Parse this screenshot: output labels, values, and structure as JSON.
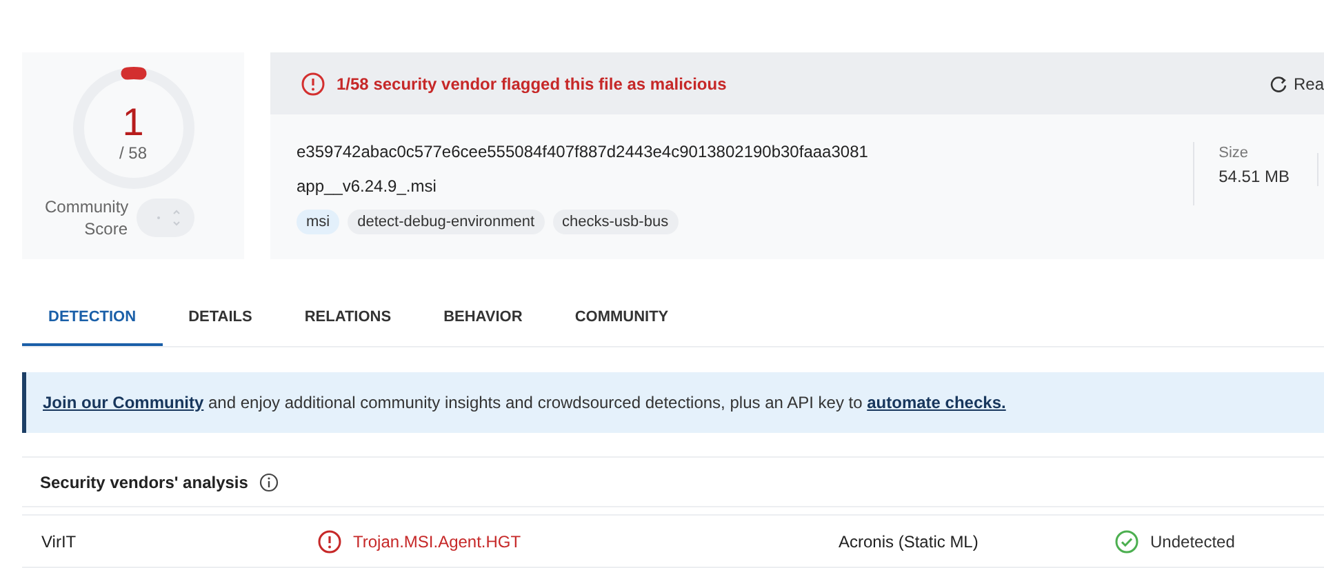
{
  "score": {
    "detections": "1",
    "total": "/ 58",
    "label": "Community Score"
  },
  "alert": {
    "text": "1/58 security vendor flagged this file as malicious",
    "action": "Rea"
  },
  "file": {
    "hash": "e359742abac0c577e6cee555084f407f887d2443e4c9013802190b30faaa3081",
    "name": "app__v6.24.9_.msi",
    "tags": [
      {
        "label": "msi",
        "color": "#e3f0fb"
      },
      {
        "label": "detect-debug-environment",
        "color": "#eceef1"
      },
      {
        "label": "checks-usb-bus",
        "color": "#eceef1"
      }
    ],
    "size_label": "Size",
    "size": "54.51 MB"
  },
  "tabs": [
    {
      "label": "DETECTION",
      "selected": true
    },
    {
      "label": "DETAILS",
      "selected": false
    },
    {
      "label": "RELATIONS",
      "selected": false
    },
    {
      "label": "BEHAVIOR",
      "selected": false
    },
    {
      "label": "COMMUNITY",
      "selected": false
    }
  ],
  "banner": {
    "link": "Join our Community",
    "text": " and enjoy additional community insights and crowdsourced detections, plus an API key to ",
    "link2": "automate checks."
  },
  "section_title": "Security vendors' analysis",
  "rows": [
    [
      {
        "vendor": "VirIT",
        "kind": "malicious",
        "result": "Trojan.MSI.Agent.HGT"
      },
      {
        "vendor": "Acronis (Static ML)",
        "kind": "undetected",
        "result": "Undetected"
      }
    ]
  ]
}
